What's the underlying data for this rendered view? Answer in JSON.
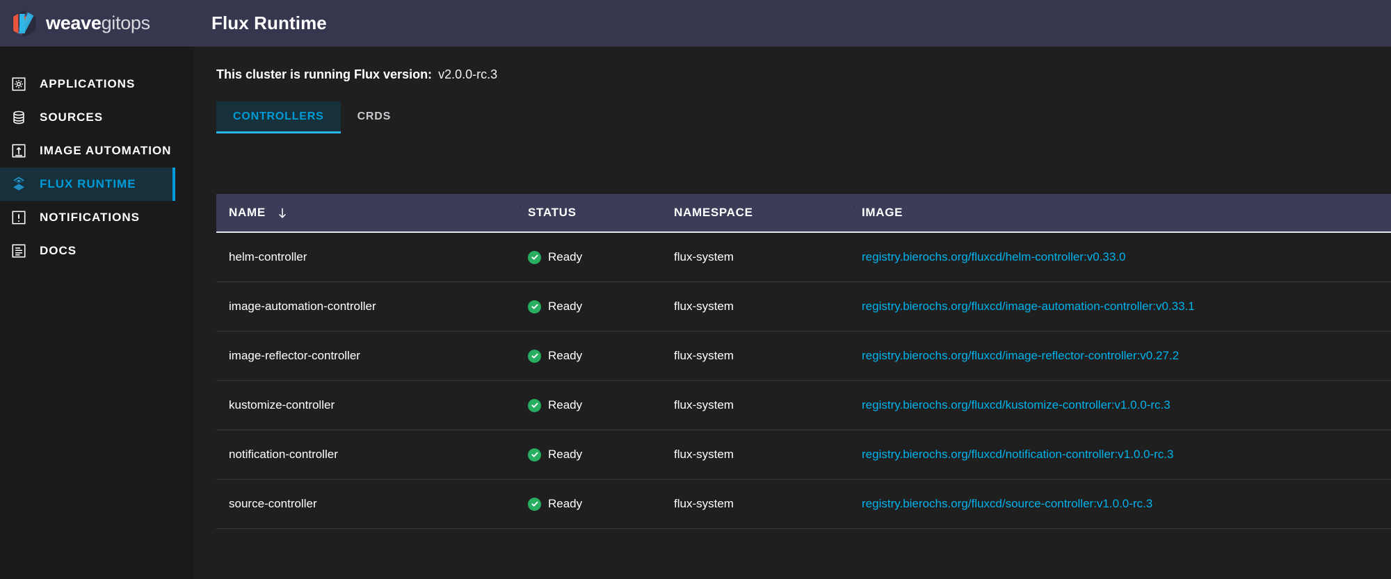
{
  "brand": {
    "name_bold": "weave",
    "name_light": "gitops",
    "logo_icon": "weave-hexagon-logo",
    "colors": {
      "orange": "#e8563f",
      "blue": "#2eb7e8",
      "slate": "#4b5071"
    }
  },
  "header": {
    "title": "Flux Runtime"
  },
  "sidebar": {
    "items": [
      {
        "label": "APPLICATIONS",
        "icon": "applications-gear-icon",
        "active": false
      },
      {
        "label": "SOURCES",
        "icon": "sources-database-icon",
        "active": false
      },
      {
        "label": "IMAGE AUTOMATION",
        "icon": "image-automation-icon",
        "active": false
      },
      {
        "label": "FLUX RUNTIME",
        "icon": "flux-runtime-diamond-icon",
        "active": true
      },
      {
        "label": "NOTIFICATIONS",
        "icon": "notifications-alert-icon",
        "active": false
      },
      {
        "label": "DOCS",
        "icon": "docs-book-icon",
        "active": false
      }
    ]
  },
  "main": {
    "version_label": "This cluster is running Flux version:",
    "version_value": "v2.0.0-rc.3",
    "tabs": [
      {
        "label": "CONTROLLERS",
        "active": true
      },
      {
        "label": "CRDS",
        "active": false
      }
    ],
    "table": {
      "columns": [
        {
          "label": "NAME",
          "sort_icon": "sort-descending-arrow-icon"
        },
        {
          "label": "STATUS"
        },
        {
          "label": "NAMESPACE"
        },
        {
          "label": "IMAGE"
        }
      ],
      "rows": [
        {
          "name": "helm-controller",
          "status": "Ready",
          "status_icon": "success-check-icon",
          "namespace": "flux-system",
          "image": "registry.bierochs.org/fluxcd/helm-controller:v0.33.0"
        },
        {
          "name": "image-automation-controller",
          "status": "Ready",
          "status_icon": "success-check-icon",
          "namespace": "flux-system",
          "image": "registry.bierochs.org/fluxcd/image-automation-controller:v0.33.1"
        },
        {
          "name": "image-reflector-controller",
          "status": "Ready",
          "status_icon": "success-check-icon",
          "namespace": "flux-system",
          "image": "registry.bierochs.org/fluxcd/image-reflector-controller:v0.27.2"
        },
        {
          "name": "kustomize-controller",
          "status": "Ready",
          "status_icon": "success-check-icon",
          "namespace": "flux-system",
          "image": "registry.bierochs.org/fluxcd/kustomize-controller:v1.0.0-rc.3"
        },
        {
          "name": "notification-controller",
          "status": "Ready",
          "status_icon": "success-check-icon",
          "namespace": "flux-system",
          "image": "registry.bierochs.org/fluxcd/notification-controller:v1.0.0-rc.3"
        },
        {
          "name": "source-controller",
          "status": "Ready",
          "status_icon": "success-check-icon",
          "namespace": "flux-system",
          "image": "registry.bierochs.org/fluxcd/source-controller:v1.0.0-rc.3"
        }
      ]
    }
  },
  "colors": {
    "accent_cyan": "#009bd8",
    "link_cyan": "#00b3ec",
    "success_green": "#27ae60",
    "header_slate": "#36374f",
    "table_header_slate": "#3b3c57",
    "background": "#1a1a1a"
  }
}
